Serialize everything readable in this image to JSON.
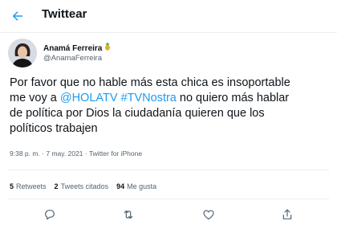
{
  "header": {
    "title": "Twittear",
    "back_icon": "arrow-left-icon"
  },
  "author": {
    "display_name": "Anamá Ferreira",
    "emoji": "pineapple",
    "handle": "@AnamaFerreira"
  },
  "tweet": {
    "line1": "Por favor que no hable más esta chica es insoportable",
    "line2_prefix": "me voy a ",
    "mention": "@HOLATV",
    "hashtag": "#TVNostra",
    "line2_suffix": " no quiero más hablar",
    "line3": "de política por Dios  la ciudadanía quieren que los",
    "line4": "políticos trabajen"
  },
  "meta": {
    "time": "9:38 p. m.",
    "separator1": " · ",
    "date": "7 may. 2021",
    "separator2": " · ",
    "source": "Twitter for iPhone"
  },
  "stats": {
    "retweets_count": "5",
    "retweets_label": "Retweets",
    "quotes_count": "2",
    "quotes_label": "Tweets citados",
    "likes_count": "94",
    "likes_label": "Me gusta"
  },
  "actions": [
    "reply-icon",
    "retweet-icon",
    "like-icon",
    "share-icon"
  ],
  "colors": {
    "accent": "#1d9bf0",
    "text": "#0f1419",
    "secondary": "#536471",
    "divider": "#ebeef0"
  }
}
